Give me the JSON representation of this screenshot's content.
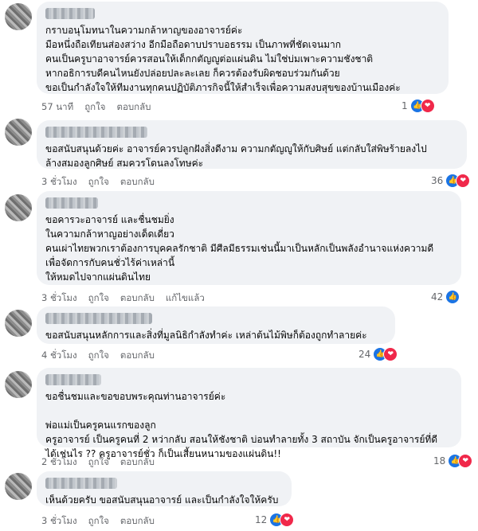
{
  "comments": [
    {
      "text": "กราบอนุโมทนาในความกล้าหาญของอาจารย์ค่ะ\nมือหนึ่งถือเทียนส่องสว่าง อีกมือถือดาบปราบอธรรม เป็นภาพที่ชัดเจนมาก\nคนเป็นครูบาอาจารย์ควรสอนให้เด็กกตัญญูต่อแผ่นดิน ไม่ใช่บ่มเพาะความชังชาติ\nหากอธิการบดีคนไหนยังปล่อยปละละเลย ก็ควรต้องรับผิดชอบร่วมกันด้วย\nขอเป็นกำลังใจให้ทีมงานทุกคนปฏิบัติภารกิจนี้ให้สำเร็จเพื่อความสงบสุขของบ้านเมืองค่ะ",
      "time": "57 นาที",
      "like": "ถูกใจ",
      "reply": "ตอบกลับ",
      "extra": "",
      "count": "1",
      "icons": [
        "like-icon",
        "love-icon"
      ]
    },
    {
      "text": "ขอสนับสนุนด้วยค่ะ อาจารย์ควรปลูกฝังสิ่งดีงาม ความกตัญญูให้กับศิษย์ แต่กลับใส่พิษร้ายลงไป\nล้างสมองลูกศิษย์ สมควรโดนลงโทษค่ะ",
      "time": "3 ชั่วโมง",
      "like": "ถูกใจ",
      "reply": "ตอบกลับ",
      "extra": "",
      "count": "36",
      "icons": [
        "like-icon",
        "love-icon"
      ]
    },
    {
      "text": "ขอคารวะอาจารย์ และชื่นชมยิ่ง\nในความกล้าหาญอย่างเด็ดเดี่ยว\nคนเผ่าไทยพวกเราต้องการบุคคลรักชาติ มีศีลมีธรรมเช่นนี้มาเป็นหลักเป็นพลังอำนาจแห่งความดี\nเพื่อจัดการกับคนชั่วไร้ค่าเหล่านี้\nให้หมดไปจากแผ่นดินไทย",
      "time": "3 ชั่วโมง",
      "like": "ถูกใจ",
      "reply": "ตอบกลับ",
      "extra": "แก้ไขแล้ว",
      "count": "42",
      "icons": [
        "like-icon"
      ]
    },
    {
      "text": "ขอสนับสนุนหลักการและสิ่งที่มูลนิธิกำลังทำค่ะ เหล่าต้นไม้พิษก็ต้องถูกทำลายค่ะ",
      "time": "4 ชั่วโมง",
      "like": "ถูกใจ",
      "reply": "ตอบกลับ",
      "extra": "",
      "count": "24",
      "icons": [
        "like-icon",
        "love-icon"
      ]
    },
    {
      "text": "ขอชื่นชมและขอขอบพระคุณท่านอาจารย์ค่ะ\n\nพ่อแม่เป็นครูคนแรกของลูก\nครูอาจารย์ เป็นครูคนที่ 2 หว่ากลับ สอนให้ชังชาติ บ่อนทำลายทั้ง 3 สถาบัน จักเป็นครูอาจารย์ที่ดี\nได้เช่นไร ?? ครูอาจารย์ชั่ว ก็เป็นเสี้ยนหนามของแผ่นดิน!!",
      "time": "2 ชั่วโมง",
      "like": "ถูกใจ",
      "reply": "ตอบกลับ",
      "extra": "",
      "count": "18",
      "icons": [
        "like-icon",
        "love-icon"
      ]
    },
    {
      "text": "เห็นด้วยครับ ขอสนับสนุนอาจารย์ และเป็นกำลังใจให้ครับ",
      "time": "3 ชั่วโมง",
      "like": "ถูกใจ",
      "reply": "ตอบกลับ",
      "extra": "",
      "count": "12",
      "icons": [
        "like-icon",
        "love-icon"
      ]
    }
  ]
}
